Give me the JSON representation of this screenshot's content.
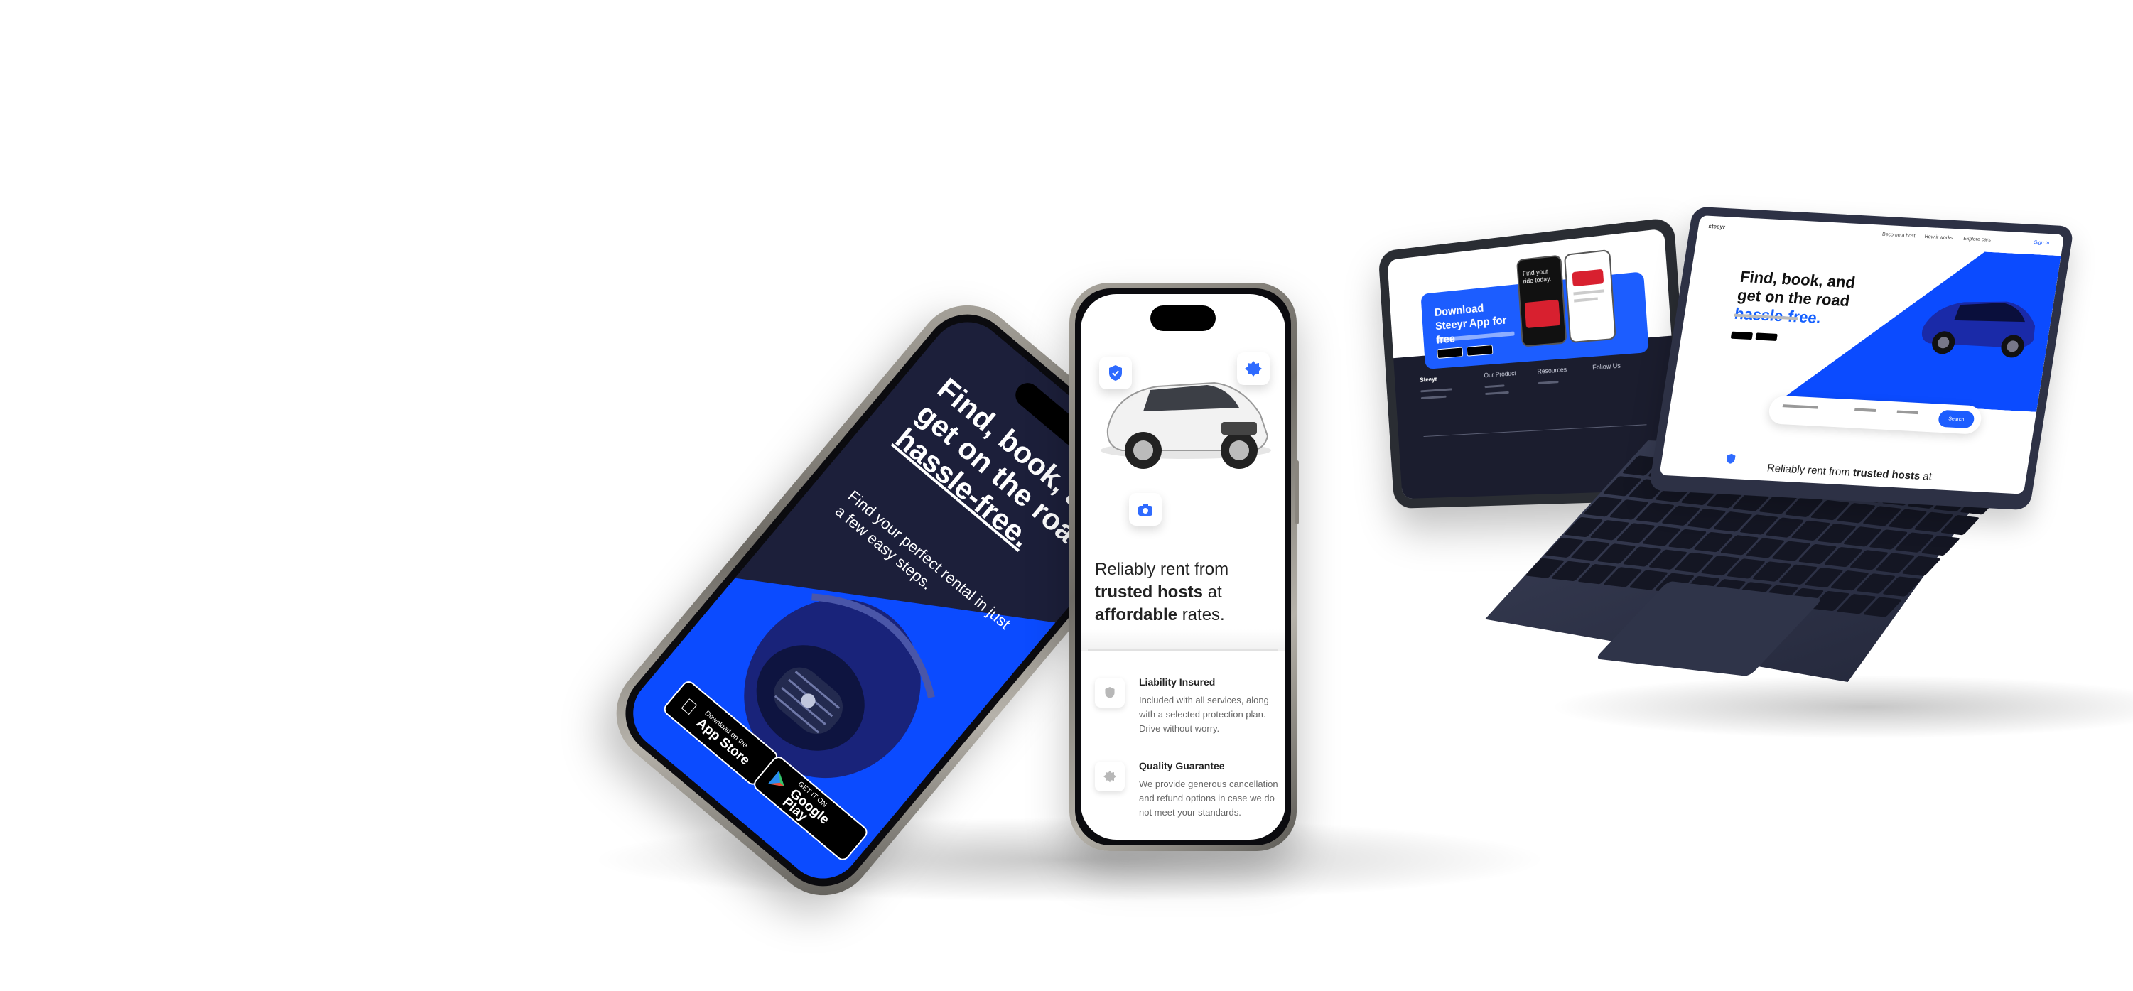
{
  "phone_app": {
    "headline_part1": "Find, book, and get on the road",
    "headline_highlight": "hassle-free.",
    "subtitle": "Find your perfect rental in just a few easy steps.",
    "app_store": {
      "small": "Download on the",
      "big": "App Store"
    },
    "google_play": {
      "small": "GET IT ON",
      "big": "Google Play"
    }
  },
  "phone_features": {
    "headline_start": "Reliably rent from",
    "headline_trusted": "trusted hosts",
    "headline_mid": "at",
    "headline_affordable": "affordable",
    "headline_end": "rates.",
    "features": [
      {
        "title": "Liability Insured",
        "desc": "Included with all services, along with a selected protection plan. Drive without worry."
      },
      {
        "title": "Quality Guarantee",
        "desc": "We provide generous cancellation and refund options in case we do not meet your standards."
      }
    ]
  },
  "tablet": {
    "banner_title": "Download Steeyr App for free",
    "mini_phone_text": "Find your ride today.",
    "footer_brand": "Steeyr",
    "footer_cols": [
      "Our Product",
      "Resources",
      "Follow Us"
    ]
  },
  "laptop": {
    "logo": "steeyr",
    "nav": [
      "Become a host",
      "How it works",
      "Explore cars",
      "Sign In"
    ],
    "headline_part1": "Find, book, and get on the road",
    "headline_highlight": "hassle-free.",
    "search_button": "Search",
    "bottom_start": "Reliably rent from",
    "bottom_trusted": "trusted hosts",
    "bottom_end": "at"
  },
  "colors": {
    "accent": "#0b4bff",
    "dark": "#1c1f3a"
  }
}
